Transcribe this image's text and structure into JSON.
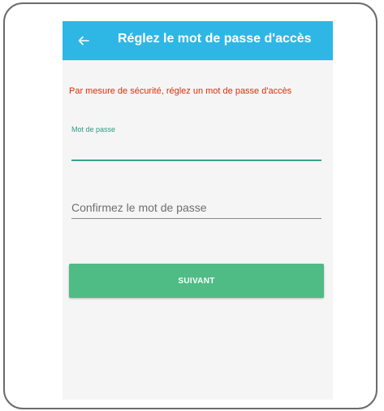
{
  "app_bar": {
    "title": "Réglez le mot de passe d'accès",
    "back_icon": "arrow-left-icon",
    "background_color": "#2eb7e5"
  },
  "form": {
    "warning": "Par mesure de sécurité, réglez un mot de passe d'accès",
    "warning_color": "#d8300c",
    "password_label": "Mot de passe",
    "password_value": "",
    "confirm_placeholder": "Confirmez le mot de passe",
    "confirm_value": "",
    "accent_color": "#3aa38b"
  },
  "actions": {
    "next_label": "SUIVANT",
    "next_color": "#4fbb85"
  }
}
